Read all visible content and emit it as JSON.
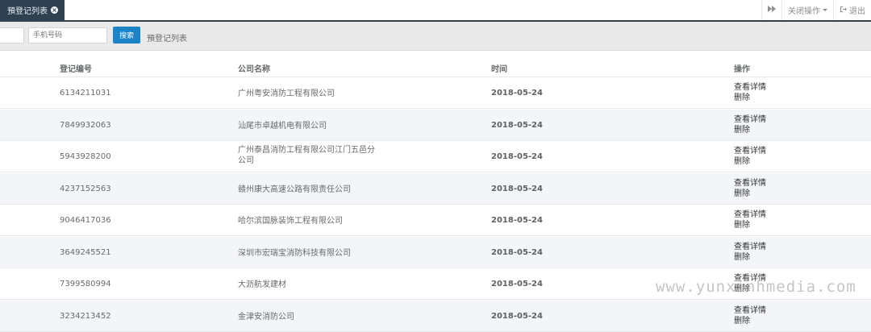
{
  "tabs": {
    "active_label": "預登记列表"
  },
  "toolbar": {
    "close_ops_label": "关闭操作",
    "logout_label": "退出"
  },
  "search": {
    "phone_placeholder": "手机号码",
    "button_label": "搜索",
    "breadcrumb": "預登记列表"
  },
  "table": {
    "headers": {
      "id": "登记编号",
      "company": "公司名称",
      "time": "时间",
      "actions": "操作"
    },
    "action_labels": {
      "view": "查看详情",
      "delete": "删除"
    },
    "rows": [
      {
        "id": "6134211031",
        "company": "广州粤安消防工程有限公司",
        "time": "2018-05-24"
      },
      {
        "id": "7849932063",
        "company": "汕尾市卓越机电有限公司",
        "time": "2018-05-24"
      },
      {
        "id": "5943928200",
        "company": "广州泰昌消防工程有限公司江门五邑分公司",
        "time": "2018-05-24"
      },
      {
        "id": "4237152563",
        "company": "赣州康大高速公路有限责任公司",
        "time": "2018-05-24"
      },
      {
        "id": "9046417036",
        "company": "哈尔滨国脉装饰工程有限公司",
        "time": "2018-05-24"
      },
      {
        "id": "3649245521",
        "company": "深圳市宏瑞宝消防科技有限公司",
        "time": "2018-05-24"
      },
      {
        "id": "7399580994",
        "company": "大沥航发建材",
        "time": "2018-05-24"
      },
      {
        "id": "3234213452",
        "company": "金津安消防公司",
        "time": "2018-05-24"
      }
    ]
  },
  "watermark": "www.yunxinhmedia.com"
}
